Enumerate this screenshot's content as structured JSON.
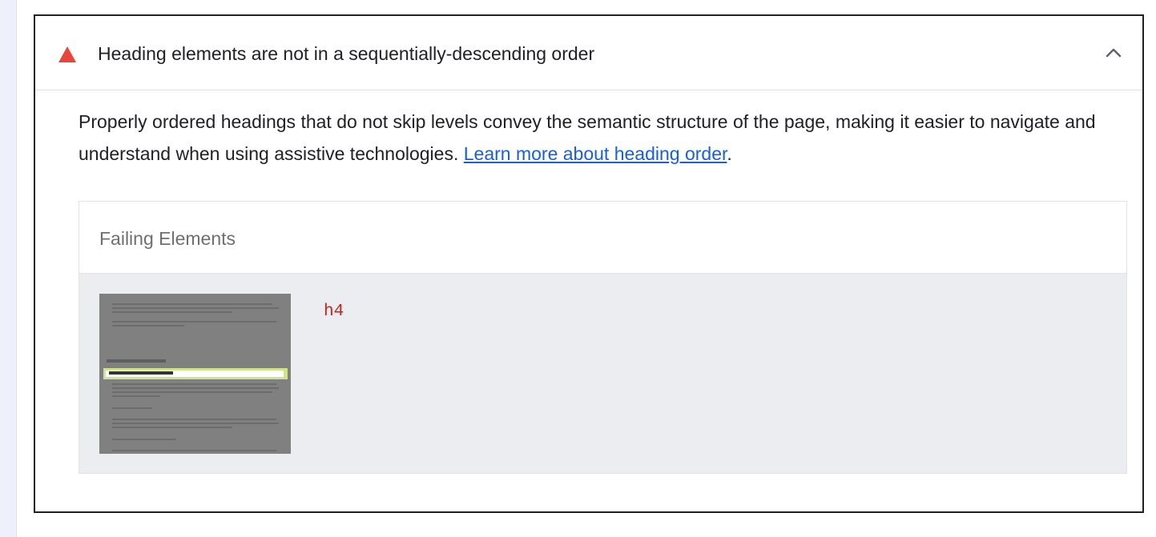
{
  "audit": {
    "title": "Heading elements are not in a sequentially-descending order",
    "status_icon": "warning-triangle-icon",
    "status_color": "#e8453c",
    "expand_icon": "chevron-up-icon",
    "description_text": "Properly ordered headings that do not skip levels convey the semantic structure of the page, making it easier to navigate and understand when using assistive technologies. ",
    "learn_more_link": "Learn more about heading order",
    "description_end": "."
  },
  "failing_table": {
    "header": "Failing Elements",
    "rows": [
      {
        "thumbnail": "element-screenshot",
        "node_label": "h4"
      }
    ]
  }
}
